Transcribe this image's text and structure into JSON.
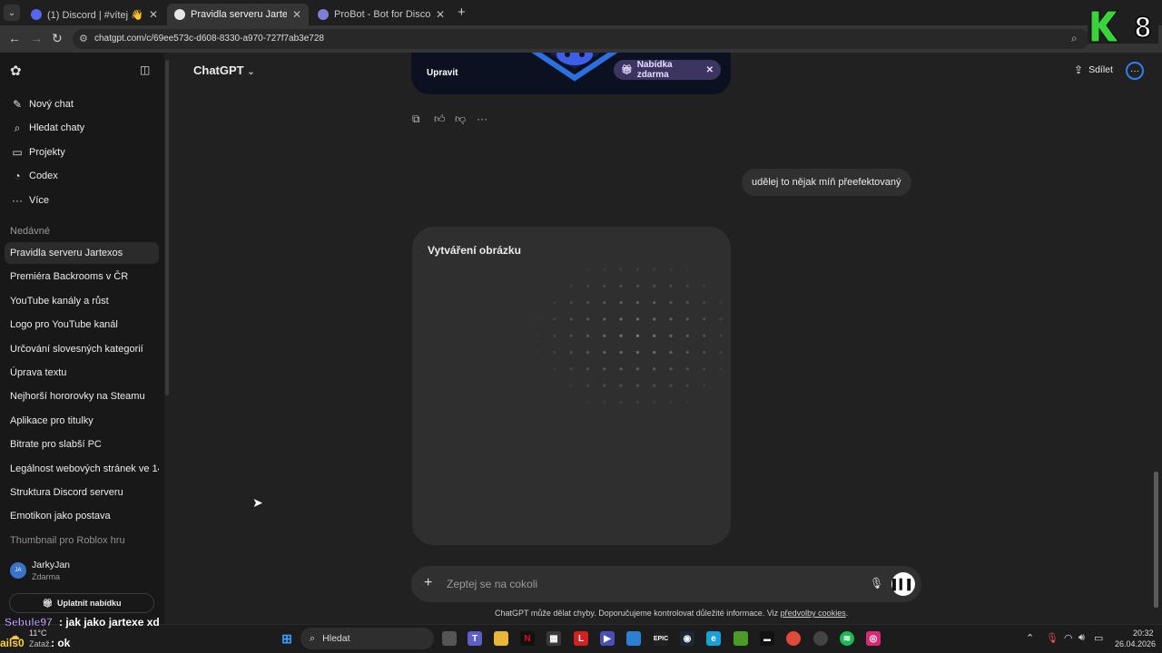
{
  "browser": {
    "tabs": [
      {
        "title": "(1) Discord | #vítej 👋 | Jartexos",
        "active": false
      },
      {
        "title": "Pravidla serveru Jartexos",
        "active": true
      },
      {
        "title": "ProBot - Bot for Discord",
        "active": false
      }
    ],
    "new_tab": "+",
    "url": "chatgpt.com/c/69ee573c-d608-8330-a970-727f7ab3e728"
  },
  "sidebar": {
    "nav": [
      {
        "label": "Nový chat",
        "icon": "✎"
      },
      {
        "label": "Hledat chaty",
        "icon": "⌕"
      },
      {
        "label": "Projekty",
        "icon": "▭"
      },
      {
        "label": "Codex",
        "icon": "◔"
      },
      {
        "label": "Více",
        "icon": "···"
      }
    ],
    "recent_label": "Nedávné",
    "recent": [
      "Pravidla serveru Jartexos",
      "Premiéra Backrooms v ČR",
      "YouTube kanály a růst",
      "Logo pro YouTube kanál",
      "Určování slovesných kategorií",
      "Úprava textu",
      "Nejhorší hororovky na Steamu",
      "Aplikace pro titulky",
      "Bitrate pro slabší PC",
      "Legálnost webových stránek ve 14",
      "Struktura Discord serveru",
      "Emotikon jako postava",
      "Thumbnail pro Roblox hru"
    ],
    "user": {
      "initials": "JA",
      "name": "JarkyJan",
      "plan": "Zdarma"
    },
    "upgrade": "Uplatnit nabídku"
  },
  "header": {
    "model": "ChatGPT",
    "share": "Sdílet"
  },
  "conversation": {
    "edit_label": "Upravit",
    "offer_chip": "Nabídka zdarma",
    "user_message": "udělej to nějak míň přeefektovaný",
    "creating_title": "Vytváření obrázku"
  },
  "composer": {
    "placeholder": "Zeptej se na cokoli",
    "disclaimer": "ChatGPT může dělat chyby. Doporučujeme kontrolovat důležité informace. Viz ",
    "disclaimer_link": "předvolby cookies",
    "disclaimer_end": "."
  },
  "overlay": {
    "badge": "8",
    "chat": [
      {
        "user": "Sebule97",
        "message": ": jak jako jartexe xd"
      },
      {
        "user": "ails0",
        "message": ": ok"
      }
    ]
  },
  "taskbar": {
    "weather_temp": "11°C",
    "weather_text": "Zataž.",
    "search": "Hledat",
    "time": "20:32",
    "date": "26.04.2026"
  },
  "colors": {
    "background": "#212121",
    "sidebar": "#181818",
    "accent": "#2f7ff0",
    "offer": "#3c3461"
  }
}
